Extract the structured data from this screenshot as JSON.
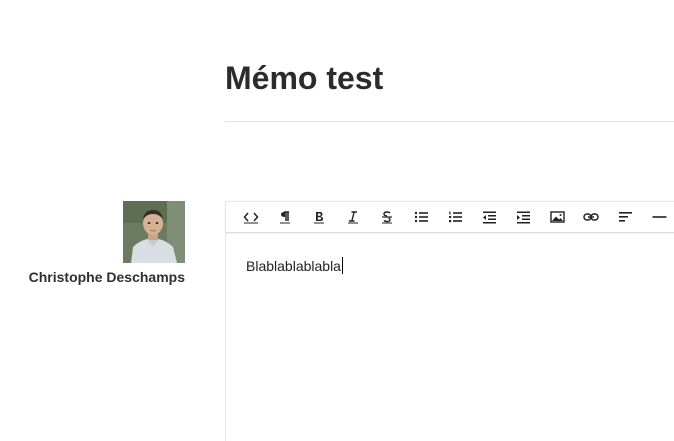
{
  "memo": {
    "title": "Mémo test"
  },
  "author": {
    "name": "Christophe Deschamps"
  },
  "editor": {
    "content": "Blablablablabla",
    "toolbar": [
      {
        "name": "code-icon"
      },
      {
        "name": "paragraph-icon"
      },
      {
        "name": "bold-icon"
      },
      {
        "name": "italic-icon"
      },
      {
        "name": "strikethrough-icon"
      },
      {
        "name": "bullet-list-icon"
      },
      {
        "name": "numbered-list-icon"
      },
      {
        "name": "outdent-icon"
      },
      {
        "name": "indent-icon"
      },
      {
        "name": "image-icon"
      },
      {
        "name": "link-icon"
      },
      {
        "name": "align-left-icon"
      },
      {
        "name": "horizontal-rule-icon"
      }
    ]
  },
  "colors": {
    "text": "#333333",
    "icon": "#222222",
    "divider": "#e3e3e3"
  }
}
